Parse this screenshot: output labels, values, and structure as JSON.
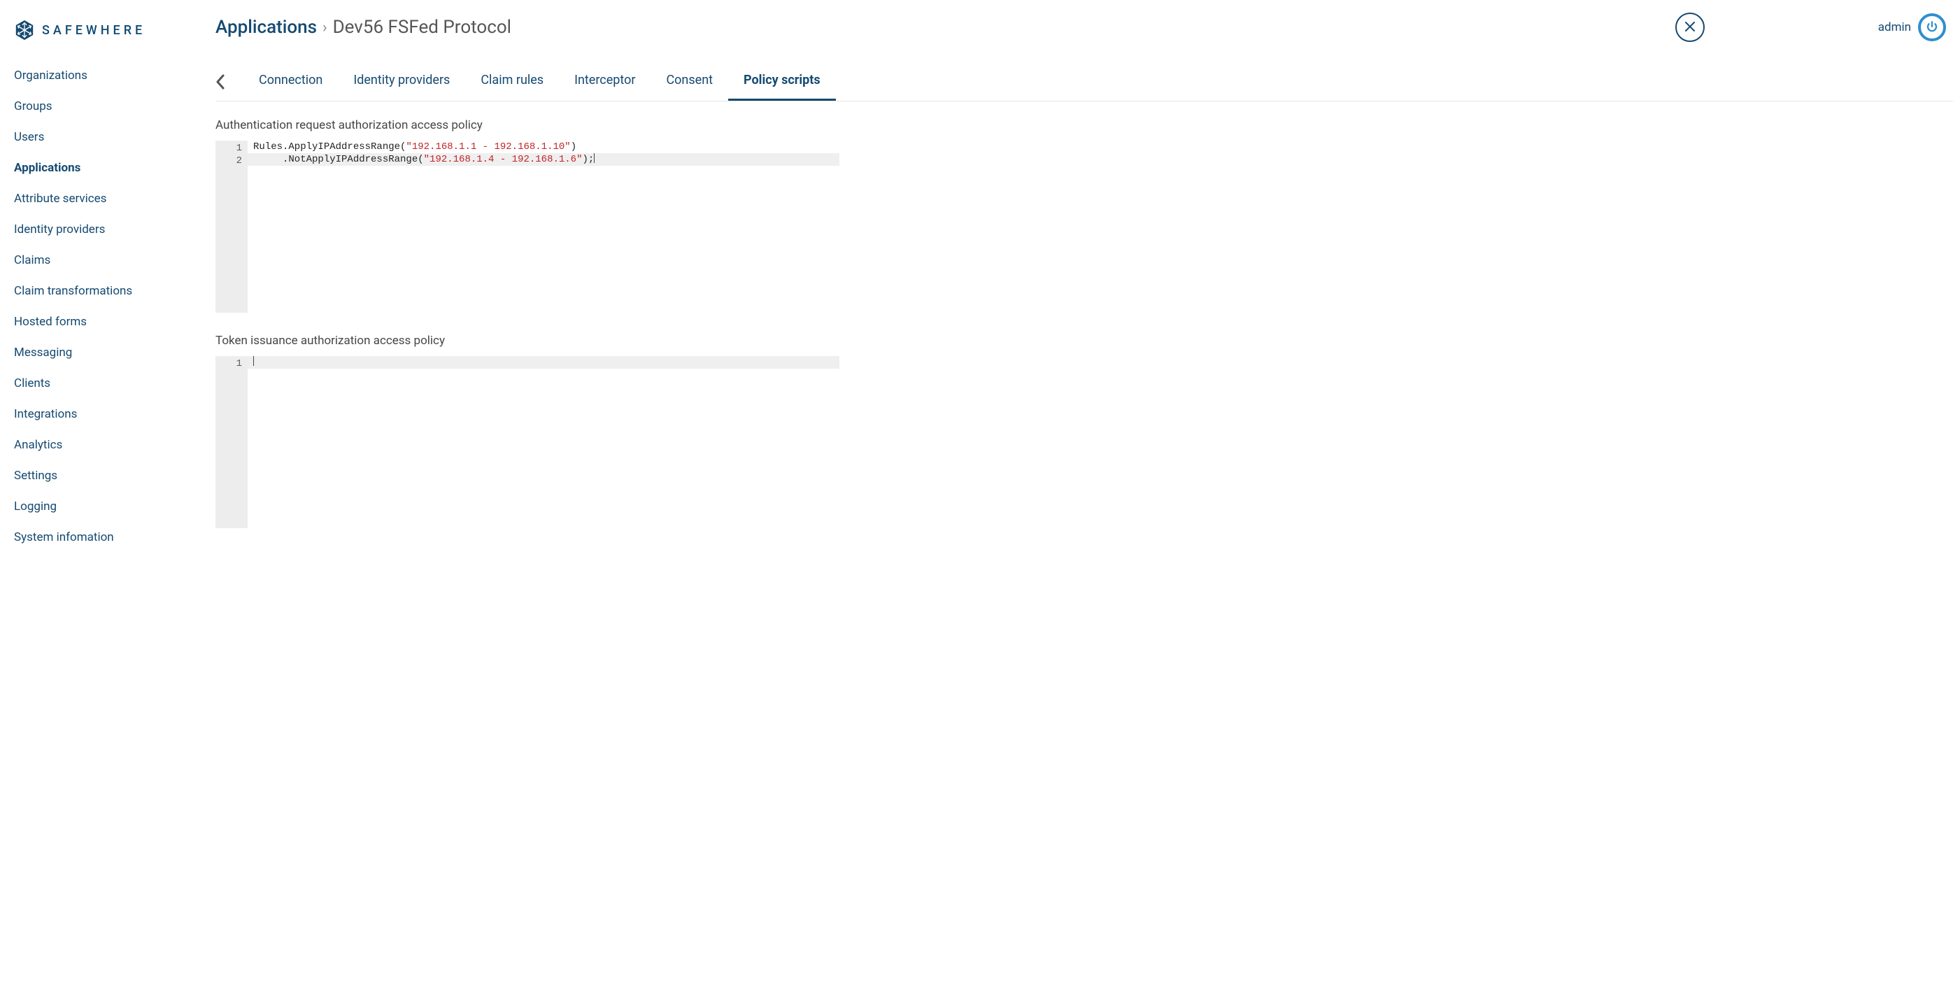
{
  "brand": {
    "name": "SAFEWHERE"
  },
  "sidebar": {
    "items": [
      {
        "label": "Organizations",
        "active": false
      },
      {
        "label": "Groups",
        "active": false
      },
      {
        "label": "Users",
        "active": false
      },
      {
        "label": "Applications",
        "active": true
      },
      {
        "label": "Attribute services",
        "active": false
      },
      {
        "label": "Identity providers",
        "active": false
      },
      {
        "label": "Claims",
        "active": false
      },
      {
        "label": "Claim transformations",
        "active": false
      },
      {
        "label": "Hosted forms",
        "active": false
      },
      {
        "label": "Messaging",
        "active": false
      },
      {
        "label": "Clients",
        "active": false
      },
      {
        "label": "Integrations",
        "active": false
      },
      {
        "label": "Analytics",
        "active": false
      },
      {
        "label": "Settings",
        "active": false
      },
      {
        "label": "Logging",
        "active": false
      },
      {
        "label": "System infomation",
        "active": false
      }
    ]
  },
  "breadcrumb": {
    "root": "Applications",
    "current": "Dev56 FSFed Protocol"
  },
  "user": {
    "name": "admin"
  },
  "tabs": [
    {
      "label": "Connection",
      "active": false
    },
    {
      "label": "Identity providers",
      "active": false
    },
    {
      "label": "Claim rules",
      "active": false
    },
    {
      "label": "Interceptor",
      "active": false
    },
    {
      "label": "Consent",
      "active": false
    },
    {
      "label": "Policy scripts",
      "active": true
    }
  ],
  "sections": {
    "auth_request": {
      "title": "Authentication request authorization access policy",
      "code": {
        "l1_a": "Rules.ApplyIPAddressRange(",
        "l1_s": "\"192.168.1.1 - 192.168.1.10\"",
        "l1_b": ")",
        "l2_a": "     .NotApplyIPAddressRange(",
        "l2_s": "\"192.168.1.4 - 192.168.1.6\"",
        "l2_b": ");"
      },
      "gutter": [
        "1",
        "2"
      ]
    },
    "token_issuance": {
      "title": "Token issuance authorization access policy",
      "gutter": [
        "1"
      ]
    }
  }
}
